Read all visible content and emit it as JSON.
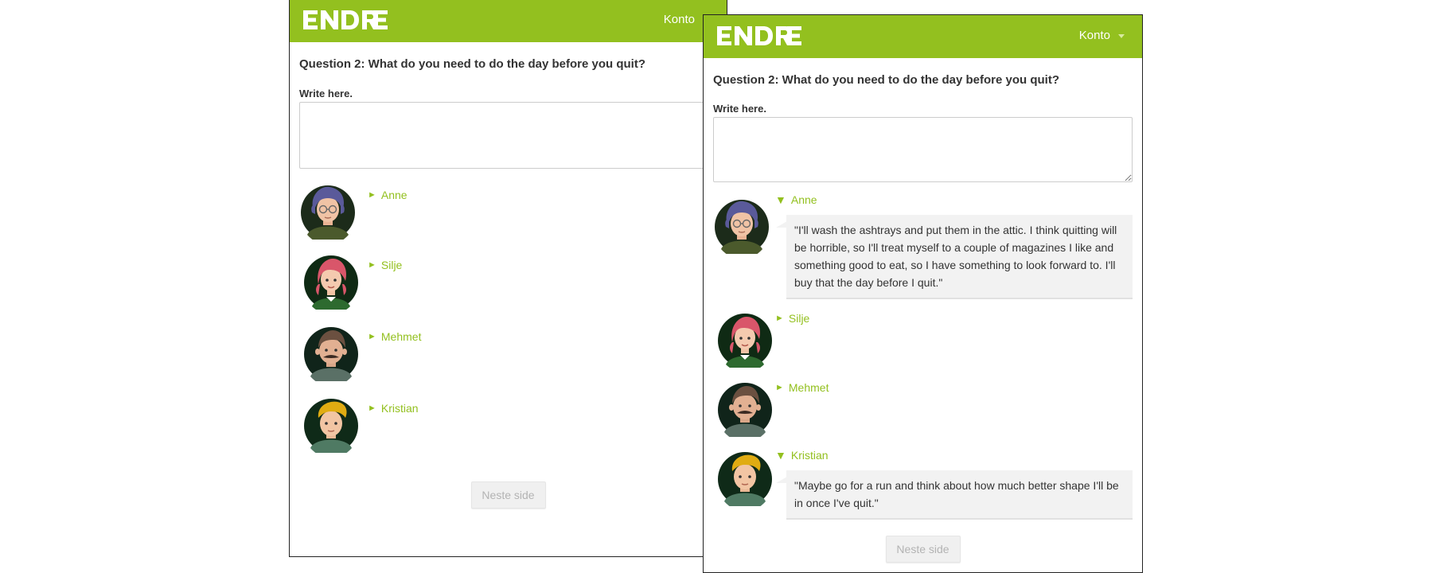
{
  "app": {
    "logo_text": "ENDRE",
    "menu_label": "Konto",
    "brand_color": "#93c01f"
  },
  "question": {
    "title": "Question 2: What do you need to do the day before you quit?",
    "write_label": "Write here.",
    "answer_value": ""
  },
  "people": [
    {
      "name": "Anne",
      "avatar_icon": "avatar-anne-icon",
      "answer": "\"I'll wash the ashtrays and put them in the attic. I think quitting will be horrible, so I'll treat myself to a couple of magazines I like and something good to eat, so I have something to look forward to. I'll buy that the day before I quit.\""
    },
    {
      "name": "Silje",
      "avatar_icon": "avatar-silje-icon",
      "answer": ""
    },
    {
      "name": "Mehmet",
      "avatar_icon": "avatar-mehmet-icon",
      "answer": ""
    },
    {
      "name": "Kristian",
      "avatar_icon": "avatar-kristian-icon",
      "answer": "\"Maybe go for a run and think about how much better shape I'll be in once I've quit.\""
    }
  ],
  "footer": {
    "next_label": "Neste side"
  },
  "glyphs": {
    "collapsed": "►",
    "expanded": "▼"
  }
}
